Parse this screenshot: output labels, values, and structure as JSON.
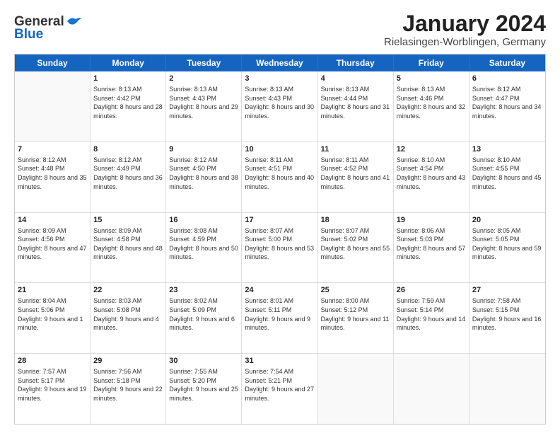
{
  "header": {
    "logo_line1": "General",
    "logo_line2": "Blue",
    "title": "January 2024",
    "subtitle": "Rielasingen-Worblingen, Germany"
  },
  "weekdays": [
    "Sunday",
    "Monday",
    "Tuesday",
    "Wednesday",
    "Thursday",
    "Friday",
    "Saturday"
  ],
  "weeks": [
    [
      {
        "day": "",
        "sunrise": "",
        "sunset": "",
        "daylight": ""
      },
      {
        "day": "1",
        "sunrise": "Sunrise: 8:13 AM",
        "sunset": "Sunset: 4:42 PM",
        "daylight": "Daylight: 8 hours and 28 minutes."
      },
      {
        "day": "2",
        "sunrise": "Sunrise: 8:13 AM",
        "sunset": "Sunset: 4:43 PM",
        "daylight": "Daylight: 8 hours and 29 minutes."
      },
      {
        "day": "3",
        "sunrise": "Sunrise: 8:13 AM",
        "sunset": "Sunset: 4:43 PM",
        "daylight": "Daylight: 8 hours and 30 minutes."
      },
      {
        "day": "4",
        "sunrise": "Sunrise: 8:13 AM",
        "sunset": "Sunset: 4:44 PM",
        "daylight": "Daylight: 8 hours and 31 minutes."
      },
      {
        "day": "5",
        "sunrise": "Sunrise: 8:13 AM",
        "sunset": "Sunset: 4:46 PM",
        "daylight": "Daylight: 8 hours and 32 minutes."
      },
      {
        "day": "6",
        "sunrise": "Sunrise: 8:12 AM",
        "sunset": "Sunset: 4:47 PM",
        "daylight": "Daylight: 8 hours and 34 minutes."
      }
    ],
    [
      {
        "day": "7",
        "sunrise": "Sunrise: 8:12 AM",
        "sunset": "Sunset: 4:48 PM",
        "daylight": "Daylight: 8 hours and 35 minutes."
      },
      {
        "day": "8",
        "sunrise": "Sunrise: 8:12 AM",
        "sunset": "Sunset: 4:49 PM",
        "daylight": "Daylight: 8 hours and 36 minutes."
      },
      {
        "day": "9",
        "sunrise": "Sunrise: 8:12 AM",
        "sunset": "Sunset: 4:50 PM",
        "daylight": "Daylight: 8 hours and 38 minutes."
      },
      {
        "day": "10",
        "sunrise": "Sunrise: 8:11 AM",
        "sunset": "Sunset: 4:51 PM",
        "daylight": "Daylight: 8 hours and 40 minutes."
      },
      {
        "day": "11",
        "sunrise": "Sunrise: 8:11 AM",
        "sunset": "Sunset: 4:52 PM",
        "daylight": "Daylight: 8 hours and 41 minutes."
      },
      {
        "day": "12",
        "sunrise": "Sunrise: 8:10 AM",
        "sunset": "Sunset: 4:54 PM",
        "daylight": "Daylight: 8 hours and 43 minutes."
      },
      {
        "day": "13",
        "sunrise": "Sunrise: 8:10 AM",
        "sunset": "Sunset: 4:55 PM",
        "daylight": "Daylight: 8 hours and 45 minutes."
      }
    ],
    [
      {
        "day": "14",
        "sunrise": "Sunrise: 8:09 AM",
        "sunset": "Sunset: 4:56 PM",
        "daylight": "Daylight: 8 hours and 47 minutes."
      },
      {
        "day": "15",
        "sunrise": "Sunrise: 8:09 AM",
        "sunset": "Sunset: 4:58 PM",
        "daylight": "Daylight: 8 hours and 48 minutes."
      },
      {
        "day": "16",
        "sunrise": "Sunrise: 8:08 AM",
        "sunset": "Sunset: 4:59 PM",
        "daylight": "Daylight: 8 hours and 50 minutes."
      },
      {
        "day": "17",
        "sunrise": "Sunrise: 8:07 AM",
        "sunset": "Sunset: 5:00 PM",
        "daylight": "Daylight: 8 hours and 53 minutes."
      },
      {
        "day": "18",
        "sunrise": "Sunrise: 8:07 AM",
        "sunset": "Sunset: 5:02 PM",
        "daylight": "Daylight: 8 hours and 55 minutes."
      },
      {
        "day": "19",
        "sunrise": "Sunrise: 8:06 AM",
        "sunset": "Sunset: 5:03 PM",
        "daylight": "Daylight: 8 hours and 57 minutes."
      },
      {
        "day": "20",
        "sunrise": "Sunrise: 8:05 AM",
        "sunset": "Sunset: 5:05 PM",
        "daylight": "Daylight: 8 hours and 59 minutes."
      }
    ],
    [
      {
        "day": "21",
        "sunrise": "Sunrise: 8:04 AM",
        "sunset": "Sunset: 5:06 PM",
        "daylight": "Daylight: 9 hours and 1 minute."
      },
      {
        "day": "22",
        "sunrise": "Sunrise: 8:03 AM",
        "sunset": "Sunset: 5:08 PM",
        "daylight": "Daylight: 9 hours and 4 minutes."
      },
      {
        "day": "23",
        "sunrise": "Sunrise: 8:02 AM",
        "sunset": "Sunset: 5:09 PM",
        "daylight": "Daylight: 9 hours and 6 minutes."
      },
      {
        "day": "24",
        "sunrise": "Sunrise: 8:01 AM",
        "sunset": "Sunset: 5:11 PM",
        "daylight": "Daylight: 9 hours and 9 minutes."
      },
      {
        "day": "25",
        "sunrise": "Sunrise: 8:00 AM",
        "sunset": "Sunset: 5:12 PM",
        "daylight": "Daylight: 9 hours and 11 minutes."
      },
      {
        "day": "26",
        "sunrise": "Sunrise: 7:59 AM",
        "sunset": "Sunset: 5:14 PM",
        "daylight": "Daylight: 9 hours and 14 minutes."
      },
      {
        "day": "27",
        "sunrise": "Sunrise: 7:58 AM",
        "sunset": "Sunset: 5:15 PM",
        "daylight": "Daylight: 9 hours and 16 minutes."
      }
    ],
    [
      {
        "day": "28",
        "sunrise": "Sunrise: 7:57 AM",
        "sunset": "Sunset: 5:17 PM",
        "daylight": "Daylight: 9 hours and 19 minutes."
      },
      {
        "day": "29",
        "sunrise": "Sunrise: 7:56 AM",
        "sunset": "Sunset: 5:18 PM",
        "daylight": "Daylight: 9 hours and 22 minutes."
      },
      {
        "day": "30",
        "sunrise": "Sunrise: 7:55 AM",
        "sunset": "Sunset: 5:20 PM",
        "daylight": "Daylight: 9 hours and 25 minutes."
      },
      {
        "day": "31",
        "sunrise": "Sunrise: 7:54 AM",
        "sunset": "Sunset: 5:21 PM",
        "daylight": "Daylight: 9 hours and 27 minutes."
      },
      {
        "day": "",
        "sunrise": "",
        "sunset": "",
        "daylight": ""
      },
      {
        "day": "",
        "sunrise": "",
        "sunset": "",
        "daylight": ""
      },
      {
        "day": "",
        "sunrise": "",
        "sunset": "",
        "daylight": ""
      }
    ]
  ]
}
